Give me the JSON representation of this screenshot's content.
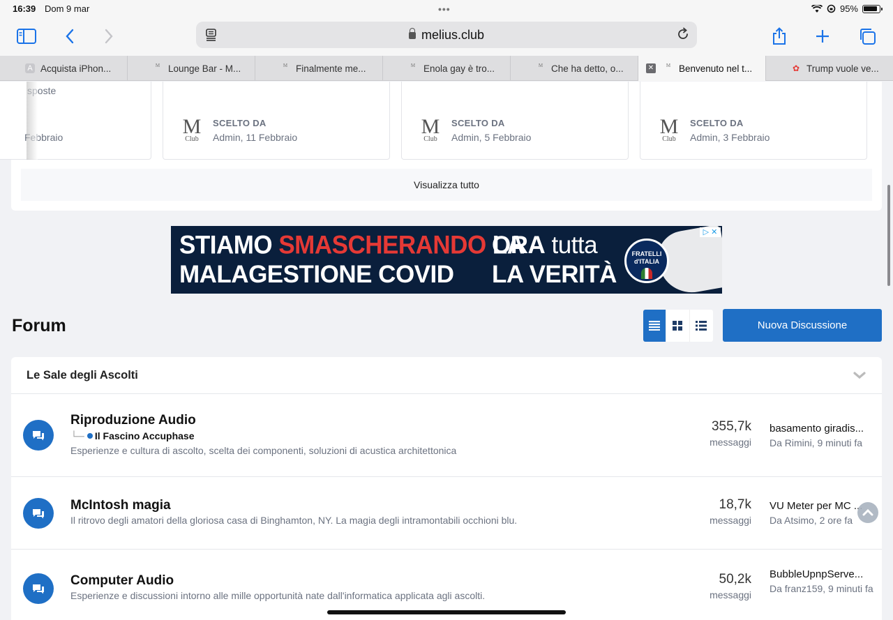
{
  "status": {
    "time": "16:39",
    "date": "Dom 9 mar",
    "battery": "95%"
  },
  "browser": {
    "url": "melius.club",
    "tabs": [
      {
        "label": "Acquista iPhon...",
        "favicon": "A"
      },
      {
        "label": "Lounge Bar - M...",
        "favicon": "M"
      },
      {
        "label": "Finalmente me...",
        "favicon": "M"
      },
      {
        "label": "Enola gay è tro...",
        "favicon": "M"
      },
      {
        "label": "Che ha detto, o...",
        "favicon": "M"
      },
      {
        "label": "Benvenuto nel t...",
        "favicon": "M",
        "active": true
      },
      {
        "label": "Trump vuole ve...",
        "favicon": "nbc"
      }
    ]
  },
  "cards": {
    "partial_text1": "sposte",
    "partial_text2": "Febbraio",
    "items": [
      {
        "label": "SCELTO DA",
        "by": "Admin, 11 Febbraio",
        "logo_m": "M",
        "logo_club": "Club"
      },
      {
        "label": "SCELTO DA",
        "by": "Admin, 5 Febbraio",
        "logo_m": "M",
        "logo_club": "Club"
      },
      {
        "label": "SCELTO DA",
        "by": "Admin, 3 Febbraio",
        "logo_m": "M",
        "logo_club": "Club"
      }
    ],
    "view_all": "Visualizza tutto"
  },
  "ad": {
    "line1_a": "STIAMO ",
    "line1_red": "SMASCHERANDO",
    "line1_b": " LA",
    "line2": "MALAGESTIONE COVID",
    "right1_a": "ORA",
    "right1_b": " tutta",
    "right2": "LA VERITÀ",
    "badge_1": "FRATELLI",
    "badge_2": "d'ITALIA"
  },
  "forum": {
    "title": "Forum",
    "new_button": "Nuova Discussione",
    "section": "Le Sale degli Ascolti",
    "rows": [
      {
        "title": "Riproduzione Audio",
        "subforum": "Il Fascino Accuphase",
        "desc": "Esperienze e cultura di ascolto, scelta dei componenti, soluzioni di acustica architettonica",
        "count": "355,7k",
        "count_label": "messaggi",
        "last_title": "basamento giradis...",
        "last_by": "Da Rimini, 9 minuti fa"
      },
      {
        "title": "McIntosh magia",
        "desc": "Il ritrovo degli amatori della gloriosa casa di Binghamton, NY. La magia degli intramontabili occhioni blu.",
        "count": "18,7k",
        "count_label": "messaggi",
        "last_title": "VU Meter per MC ...",
        "last_by": "Da Atsimo, 2 ore fa"
      },
      {
        "title": "Computer Audio",
        "desc": "Esperienze e discussioni intorno alle mille opportunità nate dall'informatica applicata agli ascolti.",
        "count": "50,2k",
        "count_label": "messaggi",
        "last_title": "BubbleUpnpServe...",
        "last_by": "Da franz159, 9 minuti fa"
      }
    ]
  },
  "colors": {
    "accent": "#1f6fc5",
    "ad_bg": "#0a1f3c",
    "ad_red": "#e53935"
  }
}
